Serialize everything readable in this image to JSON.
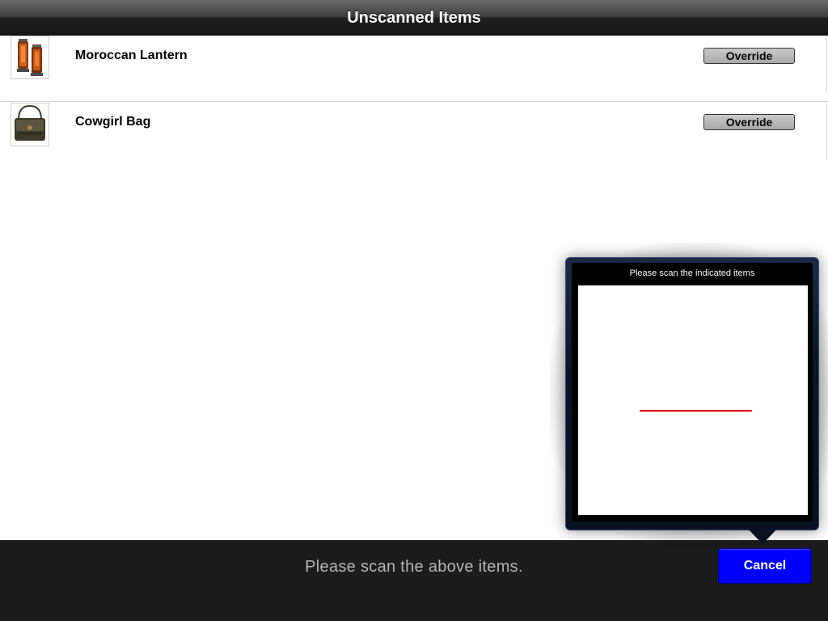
{
  "header": {
    "title": "Unscanned Items"
  },
  "items": [
    {
      "name": "Moroccan Lantern",
      "override_label": "Override",
      "thumbnail_icon": "lantern-thumbnail"
    },
    {
      "name": "Cowgirl Bag",
      "override_label": "Override",
      "thumbnail_icon": "bag-thumbnail"
    }
  ],
  "scanner": {
    "title": "Please scan the indicated items",
    "scan_line_color": "#e00000"
  },
  "footer": {
    "status": "Please scan the above items.",
    "cancel_label": "Cancel",
    "cancel_color": "#0000ff"
  }
}
